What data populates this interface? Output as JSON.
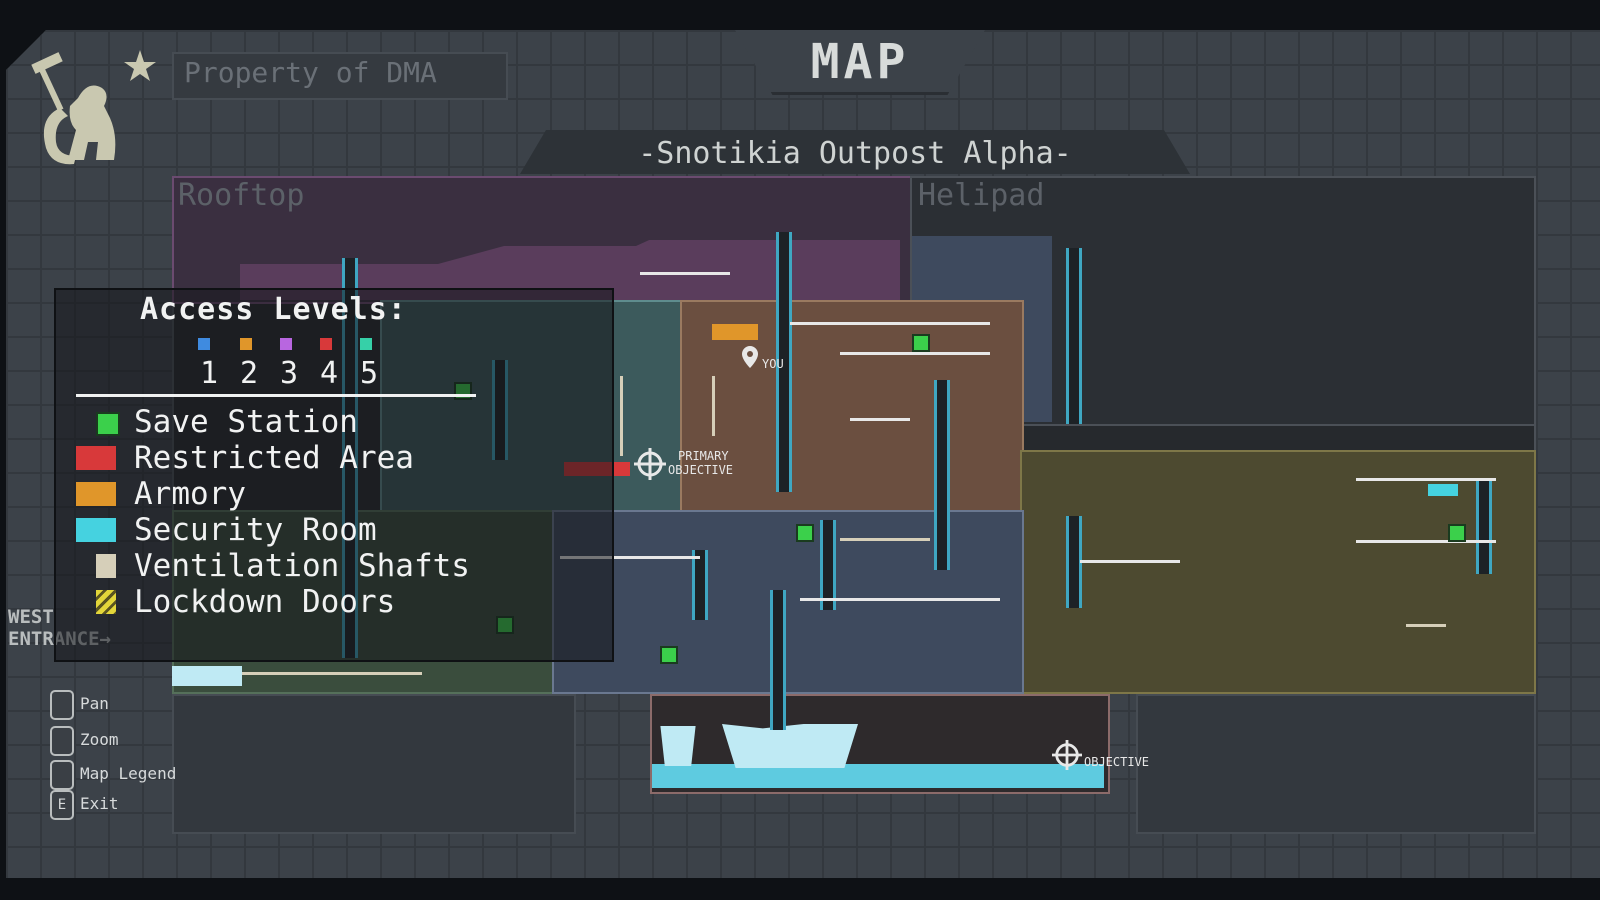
{
  "header": {
    "title": "MAP",
    "subtitle": "-Snotikia Outpost Alpha-",
    "owner_label": "Property of DMA",
    "logo_icon": "monkey-hammer-logo-icon"
  },
  "zones": {
    "rooftop": "Rooftop",
    "helipad": "Helipad"
  },
  "markers": {
    "you": "YOU",
    "primary_objective_line1": "PRIMARY",
    "primary_objective_line2": "OBJECTIVE",
    "objective": "OBJECTIVE"
  },
  "west_entrance": {
    "line1": "WEST",
    "line2": "ENTRANCE→"
  },
  "legend": {
    "title": "Access Levels:",
    "levels": [
      "1",
      "2",
      "3",
      "4",
      "5"
    ],
    "level_colors": [
      "#3f8be0",
      "#e0962a",
      "#b866e0",
      "#d8393a",
      "#36d0a8"
    ],
    "items": [
      {
        "label": "Save Station",
        "color": "#3bd04b",
        "icon": "save-station-icon"
      },
      {
        "label": "Restricted Area",
        "color": "#d8393a",
        "icon": "restricted-area-icon"
      },
      {
        "label": "Armory",
        "color": "#e0962a",
        "icon": "armory-icon"
      },
      {
        "label": "Security Room",
        "color": "#45d2e0",
        "icon": "security-room-icon"
      },
      {
        "label": "Ventilation Shafts",
        "color": "#d6cfb9",
        "icon": "ventilation-shaft-icon"
      },
      {
        "label": "Lockdown Doors",
        "color": "#e3d63a",
        "icon": "lockdown-door-icon"
      }
    ]
  },
  "controls": [
    {
      "label": "Pan",
      "key": "",
      "icon": "mouse-left-icon"
    },
    {
      "label": "Zoom",
      "key": "",
      "icon": "mouse-wheel-icon"
    },
    {
      "label": "Map Legend",
      "key": "",
      "icon": "mouse-right-icon"
    },
    {
      "label": "Exit",
      "key": "E",
      "icon": "e-key-icon"
    }
  ],
  "colors": {
    "rooftop_zone": "#5a3d5c",
    "teal_zone": "#3c5a5c",
    "brown_zone": "#6b4f40",
    "olive_zone": "#5f5832",
    "blue_zone": "#3e4a5e",
    "green_zone": "#3a4d3d",
    "water": "#5ecbe0"
  }
}
